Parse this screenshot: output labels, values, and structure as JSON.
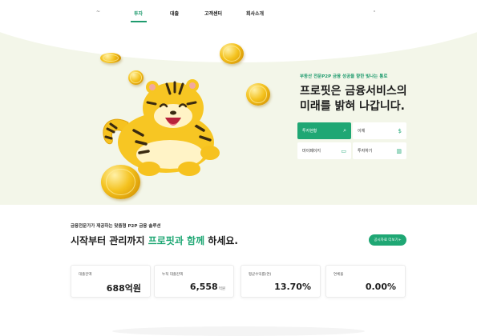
{
  "nav": {
    "logo": "~",
    "items": [
      {
        "label": "투자",
        "active": true
      },
      {
        "label": "대출",
        "active": false
      },
      {
        "label": "고객센터",
        "active": false
      },
      {
        "label": "회사소개",
        "active": false
      }
    ]
  },
  "hero": {
    "subtitle": "부동산 전문P2P 금융 성공을 향한 빛나는 통로",
    "title_line1": "프로핏은 금융서비스의",
    "title_line2": "미래를 밝혀 나갑니다.",
    "buttons": [
      {
        "label": "투자현황",
        "icon": "search-icon",
        "glyph": "⌕"
      },
      {
        "label": "이체",
        "icon": "dollar-icon",
        "glyph": "$"
      },
      {
        "label": "마이페이지",
        "icon": "folder-icon",
        "glyph": "▭"
      },
      {
        "label": "투자하기",
        "icon": "chart-icon",
        "glyph": "▥"
      }
    ]
  },
  "section": {
    "subtitle": "금융전문가가 제공하는 맞춤형 P2P 금융 솔루션",
    "title_prefix": "시작부터 관리까지 ",
    "title_highlight": "프로핏과 함께",
    "title_suffix": " 하세요.",
    "cta": "공시자료 더보기+"
  },
  "stats": [
    {
      "label": "대출잔액",
      "value": "688억원",
      "unit": ""
    },
    {
      "label": "누적 대출잔액",
      "value": "6,558",
      "unit": "억원"
    },
    {
      "label": "평균수익률(연)",
      "value": "13.70%",
      "unit": ""
    },
    {
      "label": "연체율",
      "value": "0.00%",
      "unit": ""
    }
  ],
  "colors": {
    "accent": "#1fa774",
    "hero_bg": "#f3f6e9",
    "tiger": "#f7c623"
  }
}
